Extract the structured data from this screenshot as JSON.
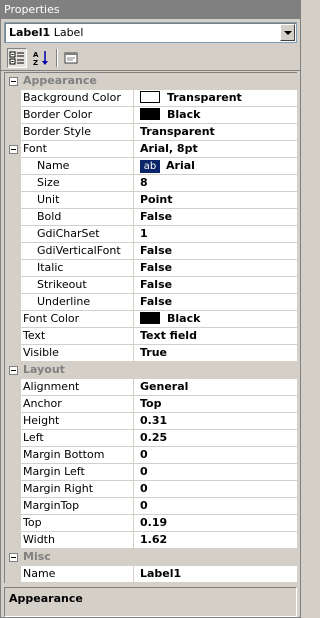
{
  "window": {
    "title": "Properties"
  },
  "object_selector": {
    "name": "Label1",
    "type": "Label"
  },
  "toolbar": {
    "buttons": [
      "categorized-icon",
      "alphabetical-icon",
      "property-pages-icon"
    ]
  },
  "groups": [
    {
      "label": "Appearance",
      "rows": [
        {
          "name": "Background Color",
          "value": "Transparent",
          "swatch": "#ffffff"
        },
        {
          "name": "Border Color",
          "value": "Black",
          "swatch": "#000000"
        },
        {
          "name": "Border Style",
          "value": "Transparent"
        },
        {
          "name": "Font",
          "value": "Arial, 8pt",
          "expander": true
        },
        {
          "name": "Name",
          "value": "Arial",
          "sub": true,
          "font_preview": "ab"
        },
        {
          "name": "Size",
          "value": "8",
          "sub": true
        },
        {
          "name": "Unit",
          "value": "Point",
          "sub": true
        },
        {
          "name": "Bold",
          "value": "False",
          "sub": true
        },
        {
          "name": "GdiCharSet",
          "value": "1",
          "sub": true
        },
        {
          "name": "GdiVerticalFont",
          "value": "False",
          "sub": true
        },
        {
          "name": "Italic",
          "value": "False",
          "sub": true
        },
        {
          "name": "Strikeout",
          "value": "False",
          "sub": true
        },
        {
          "name": "Underline",
          "value": "False",
          "sub": true
        },
        {
          "name": "Font Color",
          "value": "Black",
          "swatch": "#000000"
        },
        {
          "name": "Text",
          "value": "Text field"
        },
        {
          "name": "Visible",
          "value": "True"
        }
      ]
    },
    {
      "label": "Layout",
      "rows": [
        {
          "name": "Alignment",
          "value": "General"
        },
        {
          "name": "Anchor",
          "value": "Top"
        },
        {
          "name": "Height",
          "value": "0.31"
        },
        {
          "name": "Left",
          "value": "0.25"
        },
        {
          "name": "Margin Bottom",
          "value": "0"
        },
        {
          "name": "Margin Left",
          "value": "0"
        },
        {
          "name": "Margin Right",
          "value": "0"
        },
        {
          "name": "MarginTop",
          "value": "0"
        },
        {
          "name": "Top",
          "value": "0.19"
        },
        {
          "name": "Width",
          "value": "1.62"
        }
      ]
    },
    {
      "label": "Misc",
      "rows": [
        {
          "name": "Name",
          "value": "Label1"
        }
      ]
    }
  ],
  "description": {
    "title": "Appearance"
  },
  "colors": {
    "titlebar": "#808080",
    "panel": "#d4d0c8",
    "category_text": "#808080"
  }
}
